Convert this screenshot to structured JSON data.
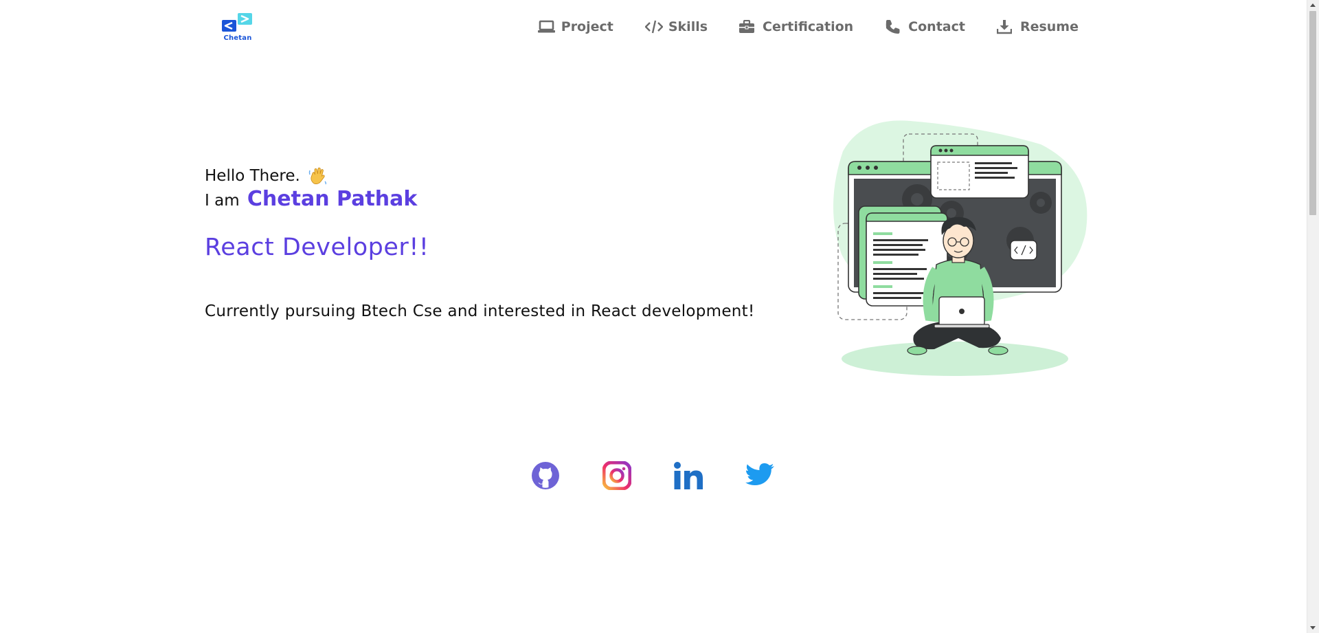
{
  "logo": {
    "text": "Chetan",
    "icon": "code-brackets-logo-icon",
    "colors": {
      "left": "#1a55d8",
      "right": "#55d6e8"
    }
  },
  "nav": {
    "items": [
      {
        "label": "Project",
        "icon": "laptop-icon"
      },
      {
        "label": "Skills",
        "icon": "code-icon"
      },
      {
        "label": "Certification",
        "icon": "briefcase-icon"
      },
      {
        "label": "Contact",
        "icon": "phone-icon"
      },
      {
        "label": "Resume",
        "icon": "download-icon"
      }
    ]
  },
  "hero": {
    "greeting": "Hello There.",
    "greeting_icon": "waving-hand-icon",
    "intro_prefix": "I am",
    "name": "Chetan Pathak",
    "role": "React Developer!!",
    "summary": "Currently pursuing Btech Cse and interested in React development!",
    "illustration": "developer-laptop-illustration"
  },
  "social": [
    {
      "name": "GitHub",
      "icon": "github-icon"
    },
    {
      "name": "Instagram",
      "icon": "instagram-icon"
    },
    {
      "name": "LinkedIn",
      "icon": "linkedin-icon"
    },
    {
      "name": "Twitter",
      "icon": "twitter-icon"
    }
  ],
  "colors": {
    "accent": "#5b3fe0",
    "nav_text": "#6b6b6b",
    "illustration_green": "#8fdc9f",
    "illustration_light_green": "#dcf6e2"
  }
}
